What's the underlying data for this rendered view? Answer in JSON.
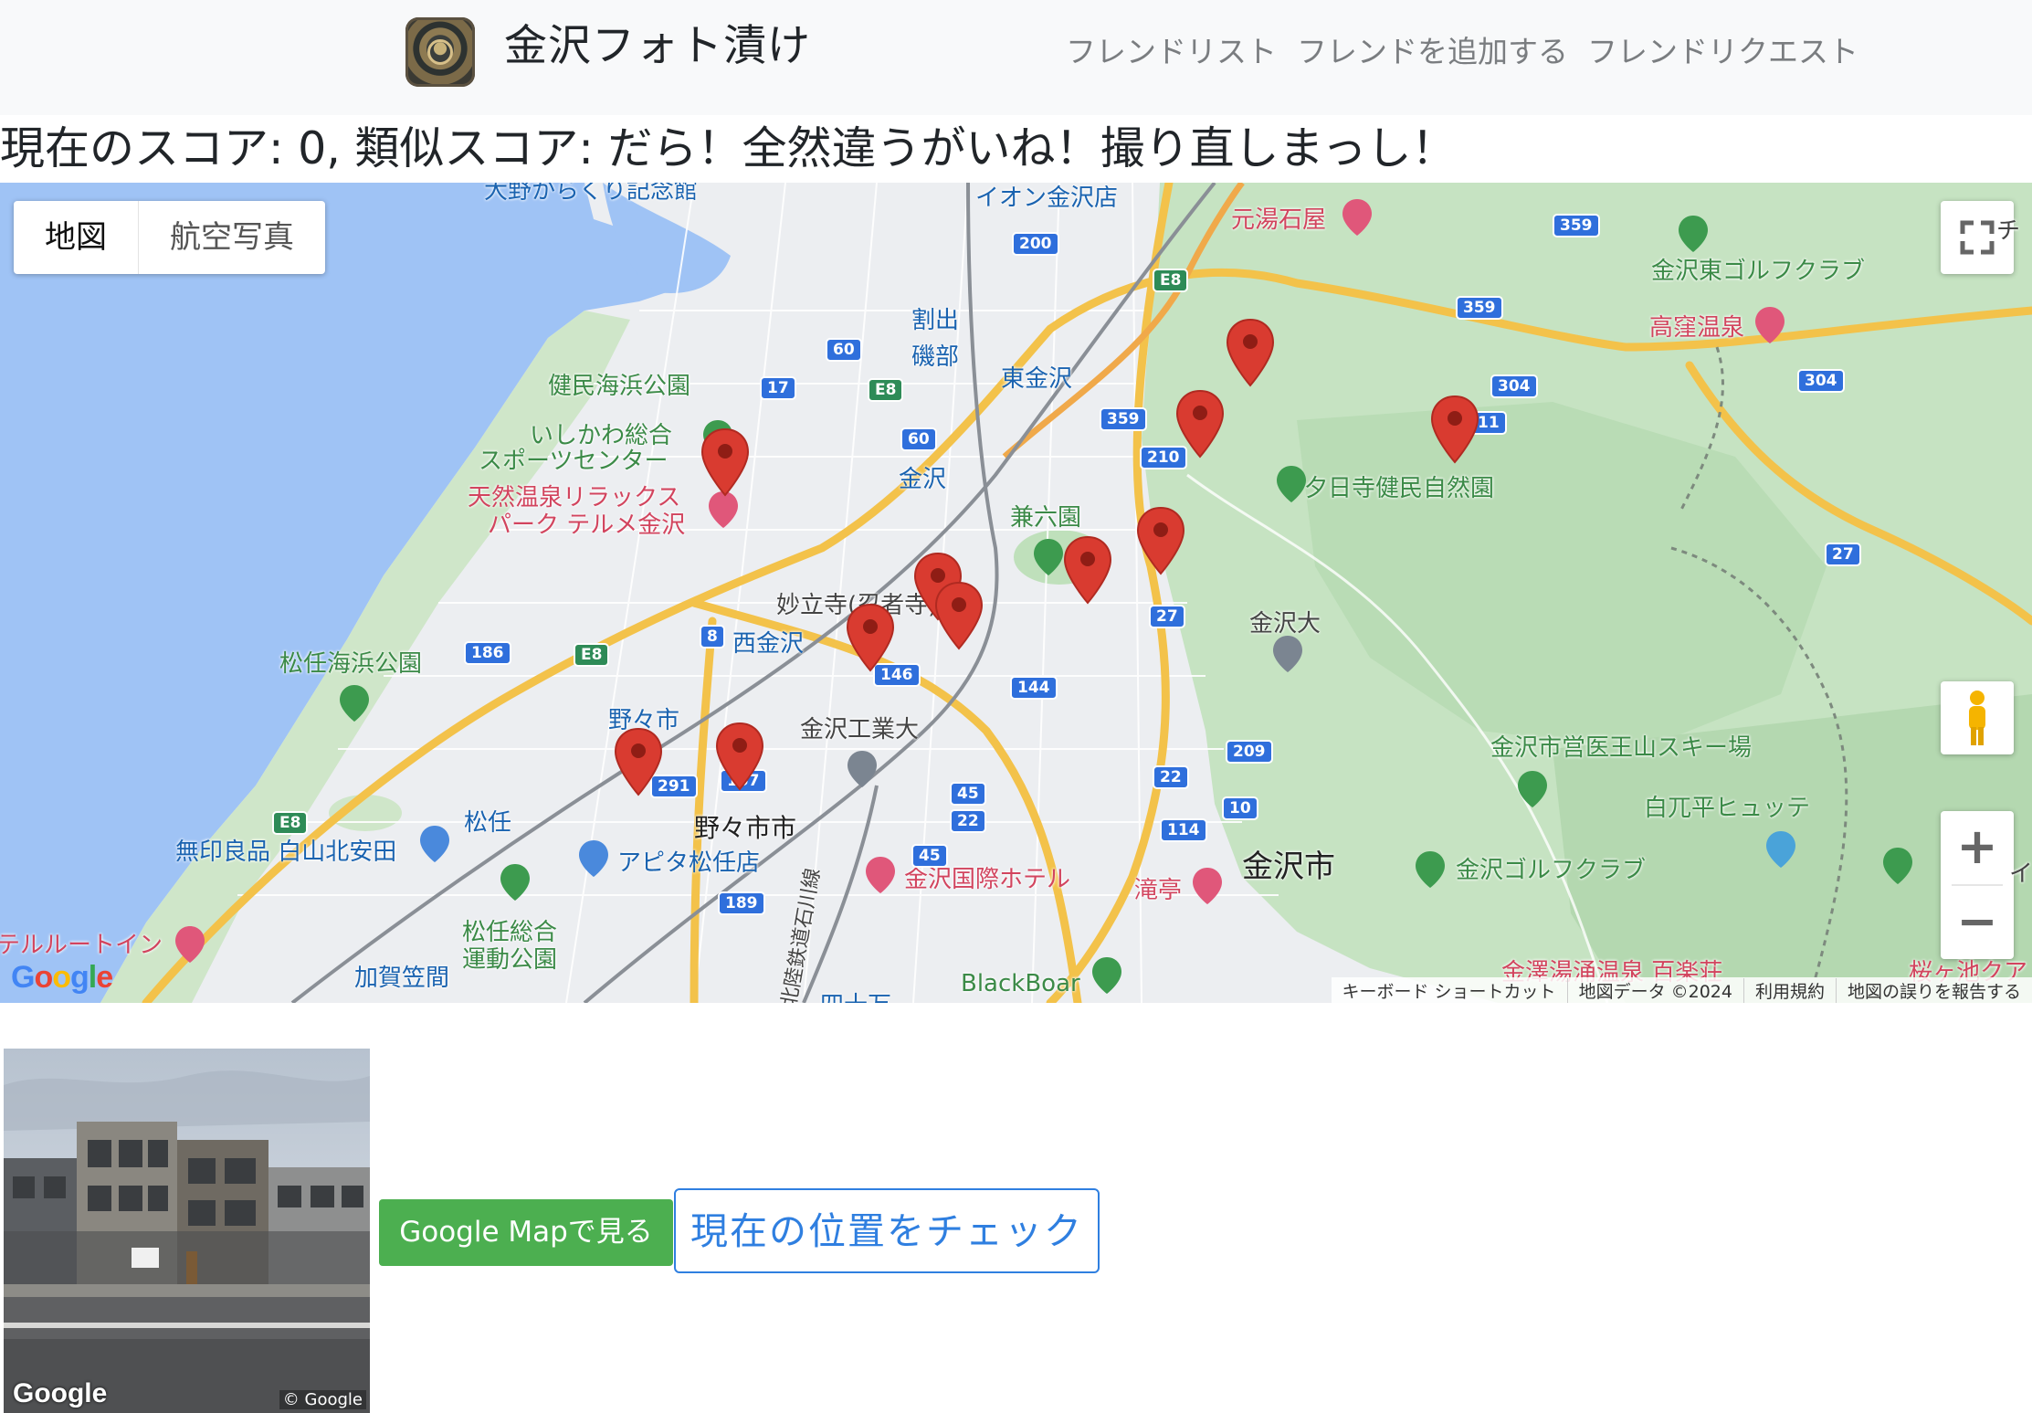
{
  "app": {
    "title": "金沢フォト漬け"
  },
  "nav": {
    "items": [
      "フレンドリスト",
      "フレンドを追加する",
      "フレンドリクエスト"
    ]
  },
  "score": {
    "text": "現在のスコア: 0, 類似スコア: だら！全然違うがいね！撮り直しまっし！"
  },
  "map": {
    "type_buttons": [
      "地図",
      "航空写真"
    ],
    "active_type": "地図",
    "zoom_in": "+",
    "zoom_out": "−",
    "footer": [
      "キーボード ショートカット",
      "地図データ ©2024",
      "利用規約",
      "地図の誤りを報告する"
    ],
    "logo_text": "Google",
    "places": {
      "ono": "大野からくり記念館",
      "aeon": "イオン金沢店",
      "motoyu": "元湯石屋",
      "higashi_golf": "金沢東ゴルフクラブ",
      "takakubo": "高窪温泉",
      "warude": "割出",
      "isobe": "磯部",
      "higashi_kanazawa": "東金沢",
      "kenmin_park": "健民海浜公園",
      "sports_center_1": "いしかわ総合",
      "sports_center_2": "スポーツセンター",
      "terme_1": "天然温泉リラックス",
      "terme_2": "パーク テルメ金沢",
      "kanazawa_st": "金沢",
      "kenrokuen": "兼六園",
      "yuhidera": "夕日寺健民自然園",
      "myoryuji": "妙立寺(忍者寺)",
      "nishi_kanazawa": "西金沢",
      "matto_beach": "松任海浜公園",
      "kanazawa_univ": "金沢大",
      "nonoichi_st": "野々市",
      "kit": "金沢工業大",
      "iouzen": "金沢市営医王山スキー場",
      "shirahage": "白兀平ヒュッテ",
      "matto": "松任",
      "nonoichi_city": "野々市市",
      "muji": "無印良品 白山北安田",
      "apita": "アピタ松任店",
      "kokusai_hotel": "金沢国際ホテル",
      "takitei": "滝亭",
      "kanazawa_city": "金沢市",
      "kanazawa_golf": "金沢ゴルフクラブ",
      "matto_sogo_1": "松任総合",
      "matto_sogo_2": "運動公園",
      "route_inn": "テルルートイン",
      "kaga_kasama": "加賀笠間",
      "blackboar": "BlackBoar",
      "hokuriku_line": "北陸鉄道石川線",
      "yuwaku": "金澤湯涌温泉 百楽荘",
      "sakuragaike": "桜ヶ池クア",
      "yon_jugo": "四十万",
      "chi_edge": "チ",
      "i_edge": "イ"
    },
    "routes": [
      "200",
      "359",
      "E8",
      "359",
      "60",
      "17",
      "E8",
      "60",
      "304",
      "304",
      "359",
      "210",
      "11",
      "27",
      "8",
      "146",
      "186",
      "E8",
      "144",
      "27",
      "209",
      "45",
      "22",
      "22",
      "10",
      "291",
      "157",
      "114",
      "45",
      "E8",
      "189"
    ]
  },
  "actions": {
    "google_map_button": "Google Mapで見る",
    "check_location_button": "現在の位置をチェック"
  },
  "photo": {
    "logo": "Google",
    "copyright": "© Google"
  }
}
